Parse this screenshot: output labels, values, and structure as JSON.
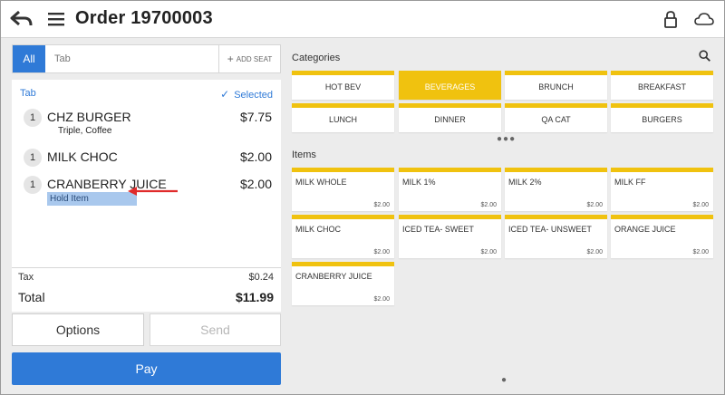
{
  "header": {
    "title": "Order 19700003"
  },
  "seats": {
    "all_label": "All",
    "tab_label": "Tab",
    "add_seat_label": "ADD SEAT"
  },
  "order": {
    "tab_label": "Tab",
    "selected_label": "Selected",
    "items": [
      {
        "qty": "1",
        "name": "CHZ BURGER",
        "price": "$7.75",
        "modifier": "Triple, Coffee"
      },
      {
        "qty": "1",
        "name": "MILK CHOC",
        "price": "$2.00"
      },
      {
        "qty": "1",
        "name": "CRANBERRY JUICE",
        "price": "$2.00",
        "hold": "Hold Item"
      }
    ],
    "tax_label": "Tax",
    "tax_value": "$0.24",
    "total_label": "Total",
    "total_value": "$11.99"
  },
  "actions": {
    "options_label": "Options",
    "send_label": "Send",
    "pay_label": "Pay"
  },
  "categories": {
    "title": "Categories",
    "items": [
      "HOT BEV",
      "BEVERAGES",
      "BRUNCH",
      "BREAKFAST",
      "LUNCH",
      "DINNER",
      "QA CAT",
      "BURGERS"
    ],
    "selected": "BEVERAGES"
  },
  "menu_items": {
    "title": "Items",
    "items": [
      {
        "name": "MILK WHOLE",
        "price": "$2.00"
      },
      {
        "name": "MILK 1%",
        "price": "$2.00"
      },
      {
        "name": "MILK 2%",
        "price": "$2.00"
      },
      {
        "name": "MILK FF",
        "price": "$2.00"
      },
      {
        "name": "MILK CHOC",
        "price": "$2.00"
      },
      {
        "name": "ICED TEA- SWEET",
        "price": "$2.00"
      },
      {
        "name": "ICED TEA- UNSWEET",
        "price": "$2.00"
      },
      {
        "name": "ORANGE JUICE",
        "price": "$2.00"
      },
      {
        "name": "CRANBERRY JUICE",
        "price": "$2.00"
      }
    ]
  },
  "colors": {
    "accent_blue": "#2f7ad7",
    "tile_yellow": "#f0c20f",
    "hold_highlight": "#a9c8ed",
    "annotation_red": "#e02b2b"
  },
  "icons": [
    "back-arrow-icon",
    "hamburger-menu-icon",
    "lock-icon",
    "cloud-icon",
    "search-icon",
    "checkmark-icon",
    "plus-icon"
  ]
}
